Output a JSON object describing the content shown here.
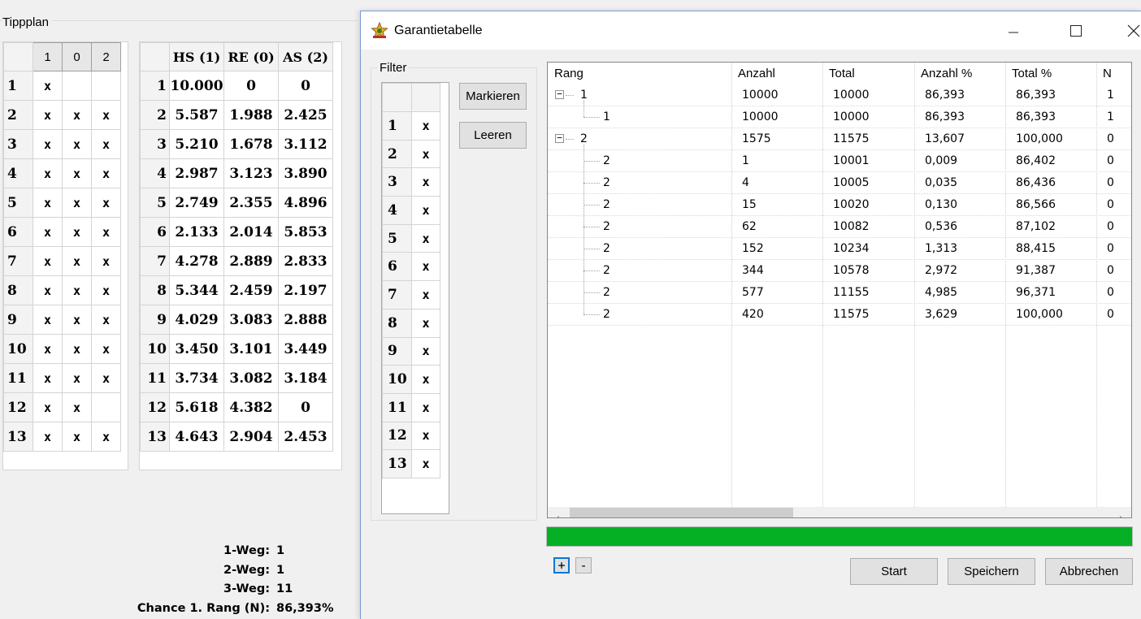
{
  "tippplan": {
    "label": "Tippplan",
    "left_grid": {
      "headers": [
        "1",
        "0",
        "2"
      ],
      "rows": [
        {
          "n": "1",
          "c": [
            "x",
            "",
            ""
          ]
        },
        {
          "n": "2",
          "c": [
            "x",
            "x",
            "x"
          ]
        },
        {
          "n": "3",
          "c": [
            "x",
            "x",
            "x"
          ]
        },
        {
          "n": "4",
          "c": [
            "x",
            "x",
            "x"
          ]
        },
        {
          "n": "5",
          "c": [
            "x",
            "x",
            "x"
          ]
        },
        {
          "n": "6",
          "c": [
            "x",
            "x",
            "x"
          ]
        },
        {
          "n": "7",
          "c": [
            "x",
            "x",
            "x"
          ]
        },
        {
          "n": "8",
          "c": [
            "x",
            "x",
            "x"
          ]
        },
        {
          "n": "9",
          "c": [
            "x",
            "x",
            "x"
          ]
        },
        {
          "n": "10",
          "c": [
            "x",
            "x",
            "x"
          ]
        },
        {
          "n": "11",
          "c": [
            "x",
            "x",
            "x"
          ]
        },
        {
          "n": "12",
          "c": [
            "x",
            "x",
            ""
          ]
        },
        {
          "n": "13",
          "c": [
            "x",
            "x",
            "x"
          ]
        }
      ]
    },
    "mid_grid": {
      "headers": [
        "HS (1)",
        "RE (0)",
        "AS (2)"
      ],
      "rows": [
        {
          "n": "1",
          "c": [
            "10.000",
            "0",
            "0"
          ]
        },
        {
          "n": "2",
          "c": [
            "5.587",
            "1.988",
            "2.425"
          ]
        },
        {
          "n": "3",
          "c": [
            "5.210",
            "1.678",
            "3.112"
          ]
        },
        {
          "n": "4",
          "c": [
            "2.987",
            "3.123",
            "3.890"
          ]
        },
        {
          "n": "5",
          "c": [
            "2.749",
            "2.355",
            "4.896"
          ]
        },
        {
          "n": "6",
          "c": [
            "2.133",
            "2.014",
            "5.853"
          ]
        },
        {
          "n": "7",
          "c": [
            "4.278",
            "2.889",
            "2.833"
          ]
        },
        {
          "n": "8",
          "c": [
            "5.344",
            "2.459",
            "2.197"
          ]
        },
        {
          "n": "9",
          "c": [
            "4.029",
            "3.083",
            "2.888"
          ]
        },
        {
          "n": "10",
          "c": [
            "3.450",
            "3.101",
            "3.449"
          ]
        },
        {
          "n": "11",
          "c": [
            "3.734",
            "3.082",
            "3.184"
          ]
        },
        {
          "n": "12",
          "c": [
            "5.618",
            "4.382",
            "0"
          ]
        },
        {
          "n": "13",
          "c": [
            "4.643",
            "2.904",
            "2.453"
          ]
        }
      ]
    },
    "stats": [
      {
        "label": "1-Weg:",
        "value": "1"
      },
      {
        "label": "2-Weg:",
        "value": "1"
      },
      {
        "label": "3-Weg:",
        "value": "11"
      },
      {
        "label": "Chance 1. Rang (N):",
        "value": "86,393%"
      }
    ]
  },
  "dialog": {
    "title": "Garantietabelle",
    "icons": {
      "app": "star-trophy-icon",
      "minimize": "minimize-icon",
      "maximize": "maximize-icon",
      "close": "close-icon"
    },
    "filter": {
      "label": "Filter",
      "rows": [
        {
          "n": "1",
          "v": "x"
        },
        {
          "n": "2",
          "v": "x"
        },
        {
          "n": "3",
          "v": "x"
        },
        {
          "n": "4",
          "v": "x"
        },
        {
          "n": "5",
          "v": "x"
        },
        {
          "n": "6",
          "v": "x"
        },
        {
          "n": "7",
          "v": "x"
        },
        {
          "n": "8",
          "v": "x"
        },
        {
          "n": "9",
          "v": "x"
        },
        {
          "n": "10",
          "v": "x"
        },
        {
          "n": "11",
          "v": "x"
        },
        {
          "n": "12",
          "v": "x"
        },
        {
          "n": "13",
          "v": "x"
        }
      ],
      "markieren_label": "Markieren",
      "leeren_label": "Leeren"
    },
    "table": {
      "columns": [
        "Rang",
        "Anzahl",
        "Total",
        "Anzahl %",
        "Total %",
        "N"
      ],
      "rows": [
        {
          "level": 0,
          "expander": "−",
          "rang": "1",
          "anzahl": "10000",
          "total": "10000",
          "anzahl_pct": "86,393",
          "total_pct": "86,393",
          "n": "1"
        },
        {
          "level": 1,
          "rang": "1",
          "anzahl": "10000",
          "total": "10000",
          "anzahl_pct": "86,393",
          "total_pct": "86,393",
          "n": "1"
        },
        {
          "level": 0,
          "expander": "−",
          "rang": "2",
          "anzahl": "1575",
          "total": "11575",
          "anzahl_pct": "13,607",
          "total_pct": "100,000",
          "n": "0"
        },
        {
          "level": 1,
          "rang": "2",
          "anzahl": "1",
          "total": "10001",
          "anzahl_pct": "0,009",
          "total_pct": "86,402",
          "n": "0"
        },
        {
          "level": 1,
          "rang": "2",
          "anzahl": "4",
          "total": "10005",
          "anzahl_pct": "0,035",
          "total_pct": "86,436",
          "n": "0"
        },
        {
          "level": 1,
          "rang": "2",
          "anzahl": "15",
          "total": "10020",
          "anzahl_pct": "0,130",
          "total_pct": "86,566",
          "n": "0"
        },
        {
          "level": 1,
          "rang": "2",
          "anzahl": "62",
          "total": "10082",
          "anzahl_pct": "0,536",
          "total_pct": "87,102",
          "n": "0"
        },
        {
          "level": 1,
          "rang": "2",
          "anzahl": "152",
          "total": "10234",
          "anzahl_pct": "1,313",
          "total_pct": "88,415",
          "n": "0"
        },
        {
          "level": 1,
          "rang": "2",
          "anzahl": "344",
          "total": "10578",
          "anzahl_pct": "2,972",
          "total_pct": "91,387",
          "n": "0"
        },
        {
          "level": 1,
          "rang": "2",
          "anzahl": "577",
          "total": "11155",
          "anzahl_pct": "4,985",
          "total_pct": "96,371",
          "n": "0"
        },
        {
          "level": 1,
          "rang": "2",
          "anzahl": "420",
          "total": "11575",
          "anzahl_pct": "3,629",
          "total_pct": "100,000",
          "n": "0"
        }
      ]
    },
    "progress": 1.0,
    "progress_color": "#06b025",
    "expand_all_label": "+",
    "collapse_all_label": "-",
    "start_label": "Start",
    "speichern_label": "Speichern",
    "abbrechen_label": "Abbrechen"
  }
}
